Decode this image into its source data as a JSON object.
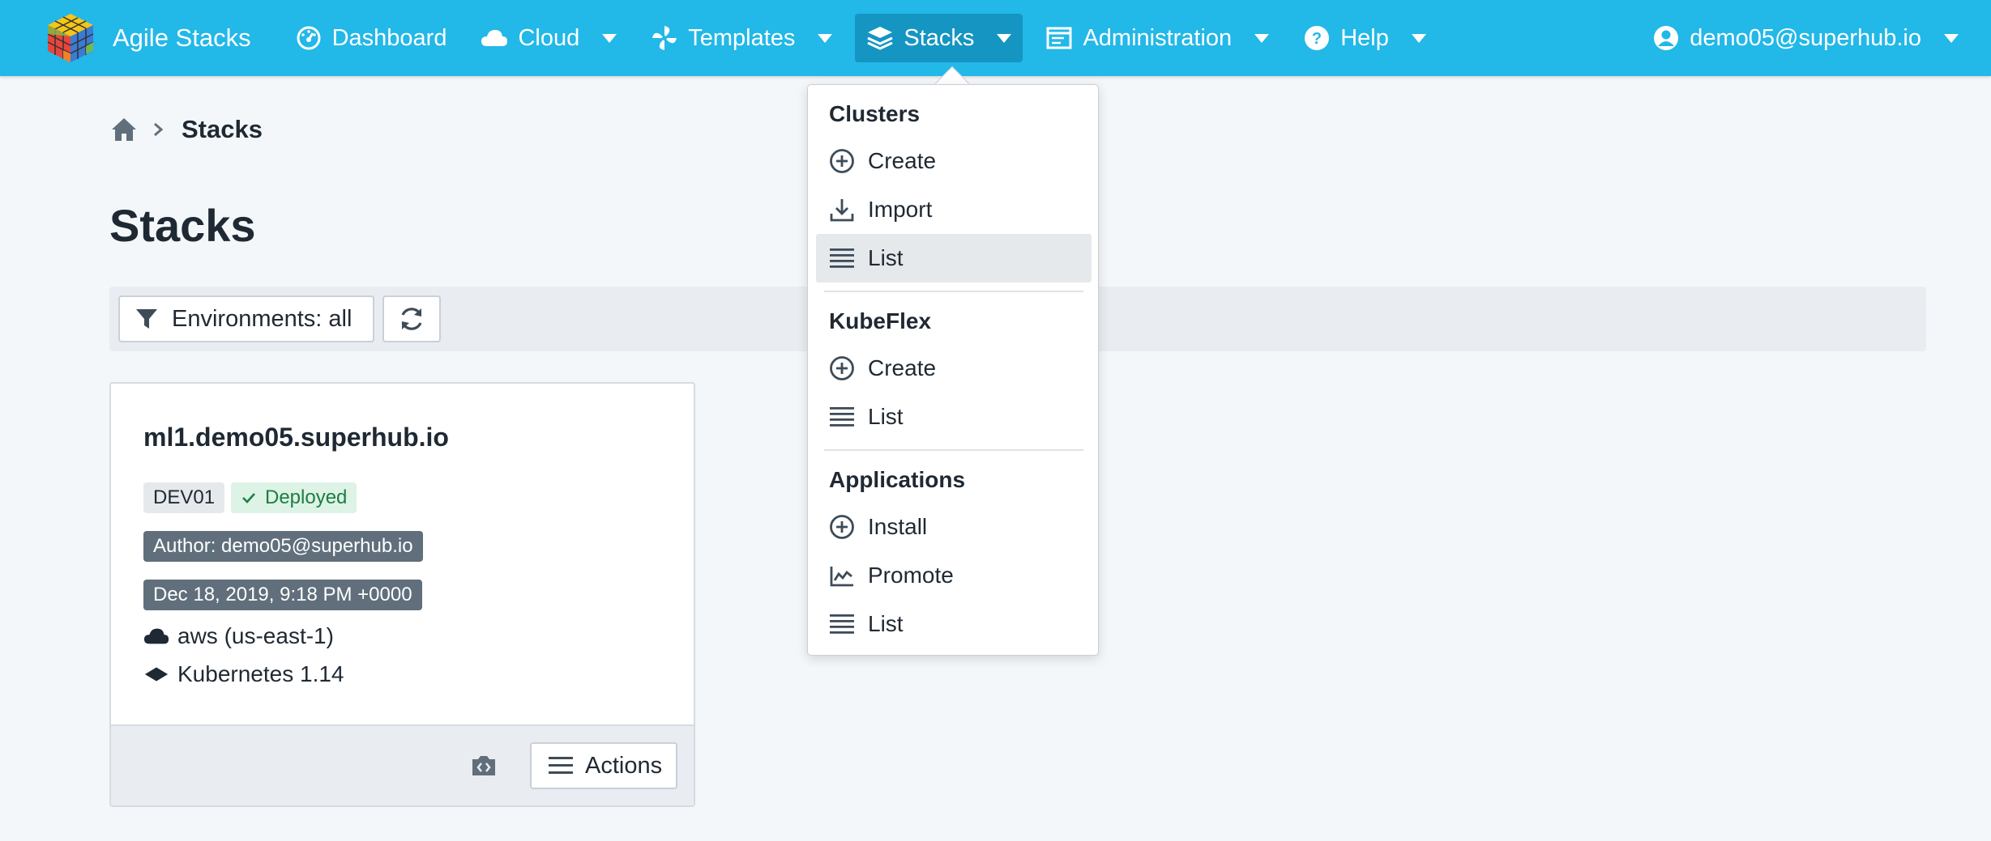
{
  "app": {
    "name": "Agile Stacks"
  },
  "nav": {
    "dashboard": "Dashboard",
    "cloud": "Cloud",
    "templates": "Templates",
    "stacks": "Stacks",
    "administration": "Administration",
    "help": "Help",
    "user": "demo05@superhub.io"
  },
  "breadcrumb": {
    "current": "Stacks"
  },
  "page": {
    "title": "Stacks"
  },
  "toolbar": {
    "filter_label": "Environments: all"
  },
  "stack_card": {
    "title": "ml1.demo05.superhub.io",
    "environment": "DEV01",
    "status": "Deployed",
    "author": "Author: demo05@superhub.io",
    "date": "Dec 18, 2019, 9:18 PM +0000",
    "cloud": "aws (us-east-1)",
    "platform": "Kubernetes 1.14",
    "actions_label": "Actions"
  },
  "stacks_menu": {
    "clusters": {
      "heading": "Clusters",
      "create": "Create",
      "import": "Import",
      "list": "List"
    },
    "kubeflex": {
      "heading": "KubeFlex",
      "create": "Create",
      "list": "List"
    },
    "applications": {
      "heading": "Applications",
      "install": "Install",
      "promote": "Promote",
      "list": "List"
    }
  },
  "colors": {
    "navbar": "#22b8e8",
    "navbar_active": "#1595c2",
    "badge_dark": "#606f7b",
    "status_green": "#1e7d43"
  }
}
